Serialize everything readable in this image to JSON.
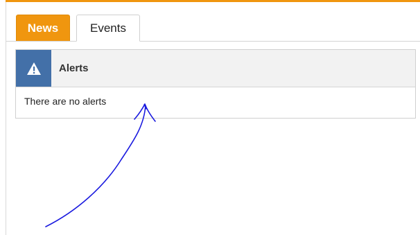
{
  "tabs": [
    {
      "label": "News",
      "active": true
    },
    {
      "label": "Events",
      "active": false
    }
  ],
  "alerts_panel": {
    "title": "Alerts",
    "icon": "warning-icon",
    "empty_message": "There are no alerts"
  },
  "colors": {
    "accent": "#f0960f",
    "icon_bg": "#4370a8",
    "header_bg": "#f2f2f2",
    "annotation_ink": "#1a1adf"
  }
}
